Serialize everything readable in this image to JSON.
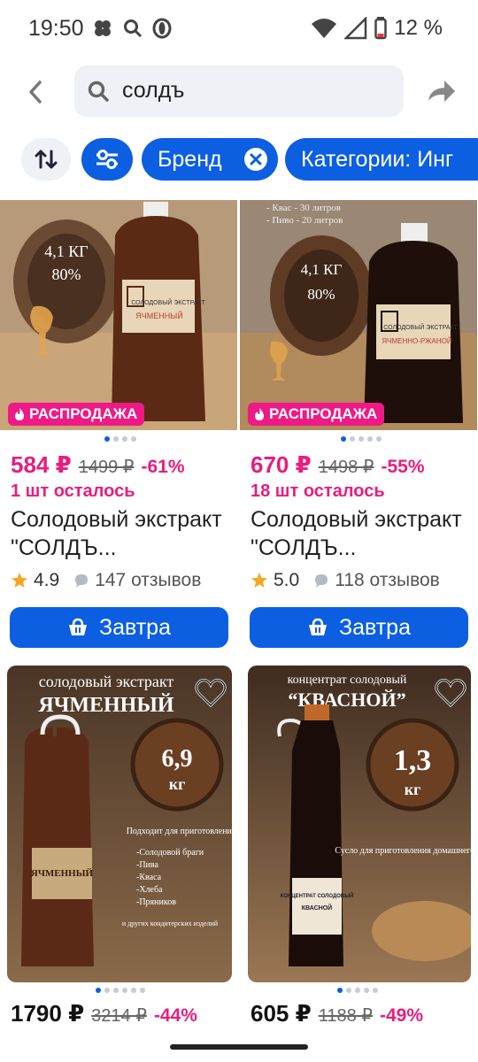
{
  "status_bar": {
    "time": "19:50",
    "battery": "12 %",
    "icons_left": [
      "cloud-icon",
      "search-icon",
      "opera-icon"
    ],
    "icons_right": [
      "wifi-icon",
      "signal-icon",
      "battery-icon"
    ]
  },
  "header": {
    "search_query": "солдъ",
    "back_icon": "back-arrow-icon",
    "share_icon": "share-icon"
  },
  "filters": {
    "brand_label": "Бренд",
    "category_label": "Категории: Инг"
  },
  "products": [
    {
      "badge": "РАСПРОДАЖА",
      "price": "584 ₽",
      "old_price": "1499 ₽",
      "discount": "-61%",
      "stock": "1 шт осталось",
      "title": "Солодовый экстракт \"СОЛДЪ...",
      "rating": "4.9",
      "reviews": "147 отзывов",
      "button": "Завтра",
      "image_text": [
        "4,1 КГ",
        "80%",
        "СОЛОДОВЫЙ ЭКСТРАКТ",
        "ЯЧМЕННЫЙ"
      ]
    },
    {
      "badge": "РАСПРОДАЖА",
      "price": "670 ₽",
      "old_price": "1498 ₽",
      "discount": "-55%",
      "stock": "18 шт осталось",
      "title": "Солодовый экстракт \"СОЛДЪ...",
      "rating": "5.0",
      "reviews": "118 отзывов",
      "button": "Завтра",
      "image_text": [
        "4,1 КГ",
        "80%",
        "СОЛОДОВЫЙ ЭКСТРАКТ",
        "ЯЧМЕННО-РЖАНОЙ",
        "- Квас - 30 литров",
        "- Пиво - 20 литров"
      ]
    },
    {
      "price": "1790 ₽",
      "old_price": "3214 ₽",
      "discount": "-44%",
      "image_text": [
        "солодовый экстракт",
        "ЯЧМЕННЫЙ",
        "6,9",
        "кг",
        "Подходит для приготовления:",
        "-Солодовой браги",
        "-Пива",
        "-Кваса",
        "-Хлеба",
        "-Пряников",
        "и других кондитерских изделий",
        "ЯЧМЕННЫЙ"
      ]
    },
    {
      "price": "605 ₽",
      "old_price": "1188 ₽",
      "discount": "-49%",
      "image_text": [
        "концентрат солодовый",
        "“КВАСНОЙ”",
        "1,3",
        "кг",
        "Сусло для приготовления домашнего кваса",
        "КОНЦЕНТРАТ СОЛОДОВЫЙ",
        "КВАСНОЙ"
      ]
    }
  ],
  "colors": {
    "accent": "#0b5fe0",
    "sale": "#e81d7c",
    "chip_bg": "#eef1f5"
  }
}
